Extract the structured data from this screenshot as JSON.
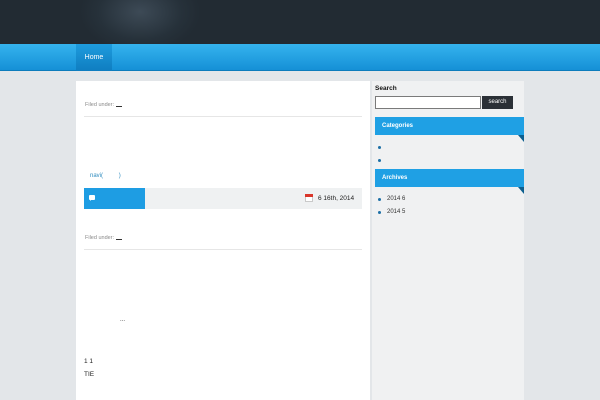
{
  "nav": {
    "home_label": "Home"
  },
  "posts": [
    {
      "filed_label": "Filed under:"
    },
    {
      "filed_label": "Filed under:"
    }
  ],
  "post_nav": {
    "navi_label": "navi(",
    "close_paren": ")"
  },
  "post_meta": {
    "date": "6  16th, 2014"
  },
  "post_body": {
    "ellipsis": "...",
    "line1": "1 1",
    "line2": "TIE"
  },
  "sidebar": {
    "search_title": "Search",
    "search_value": "",
    "search_button": "search",
    "categories_title": "Categories",
    "categories": [
      "",
      ""
    ],
    "archives_title": "Archives",
    "archives": [
      "2014 6",
      "2014 5"
    ]
  },
  "colors": {
    "accent": "#1fa0e4",
    "header_dark": "#26313a",
    "nav_blue": "#1590d6"
  }
}
